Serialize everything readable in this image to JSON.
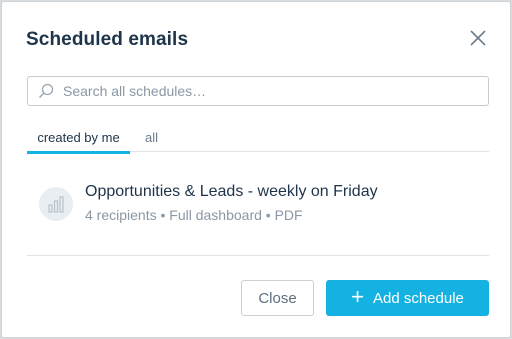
{
  "dialog": {
    "title": "Scheduled emails",
    "close_icon": "close-icon"
  },
  "search": {
    "placeholder": "Search all schedules…",
    "value": "",
    "icon": "search-icon"
  },
  "tabs": [
    {
      "label": "created by me",
      "active": true
    },
    {
      "label": "all",
      "active": false
    }
  ],
  "schedules": [
    {
      "icon": "bar-chart-icon",
      "title": "Opportunities & Leads - weekly on Friday",
      "meta": "4 recipients • Full dashboard • PDF"
    }
  ],
  "footer": {
    "close_label": "Close",
    "add_label": "Add schedule",
    "add_icon": "plus-icon"
  },
  "colors": {
    "accent": "#14b2e2",
    "title_text": "#1e3449",
    "muted_text": "#8a97a5"
  }
}
